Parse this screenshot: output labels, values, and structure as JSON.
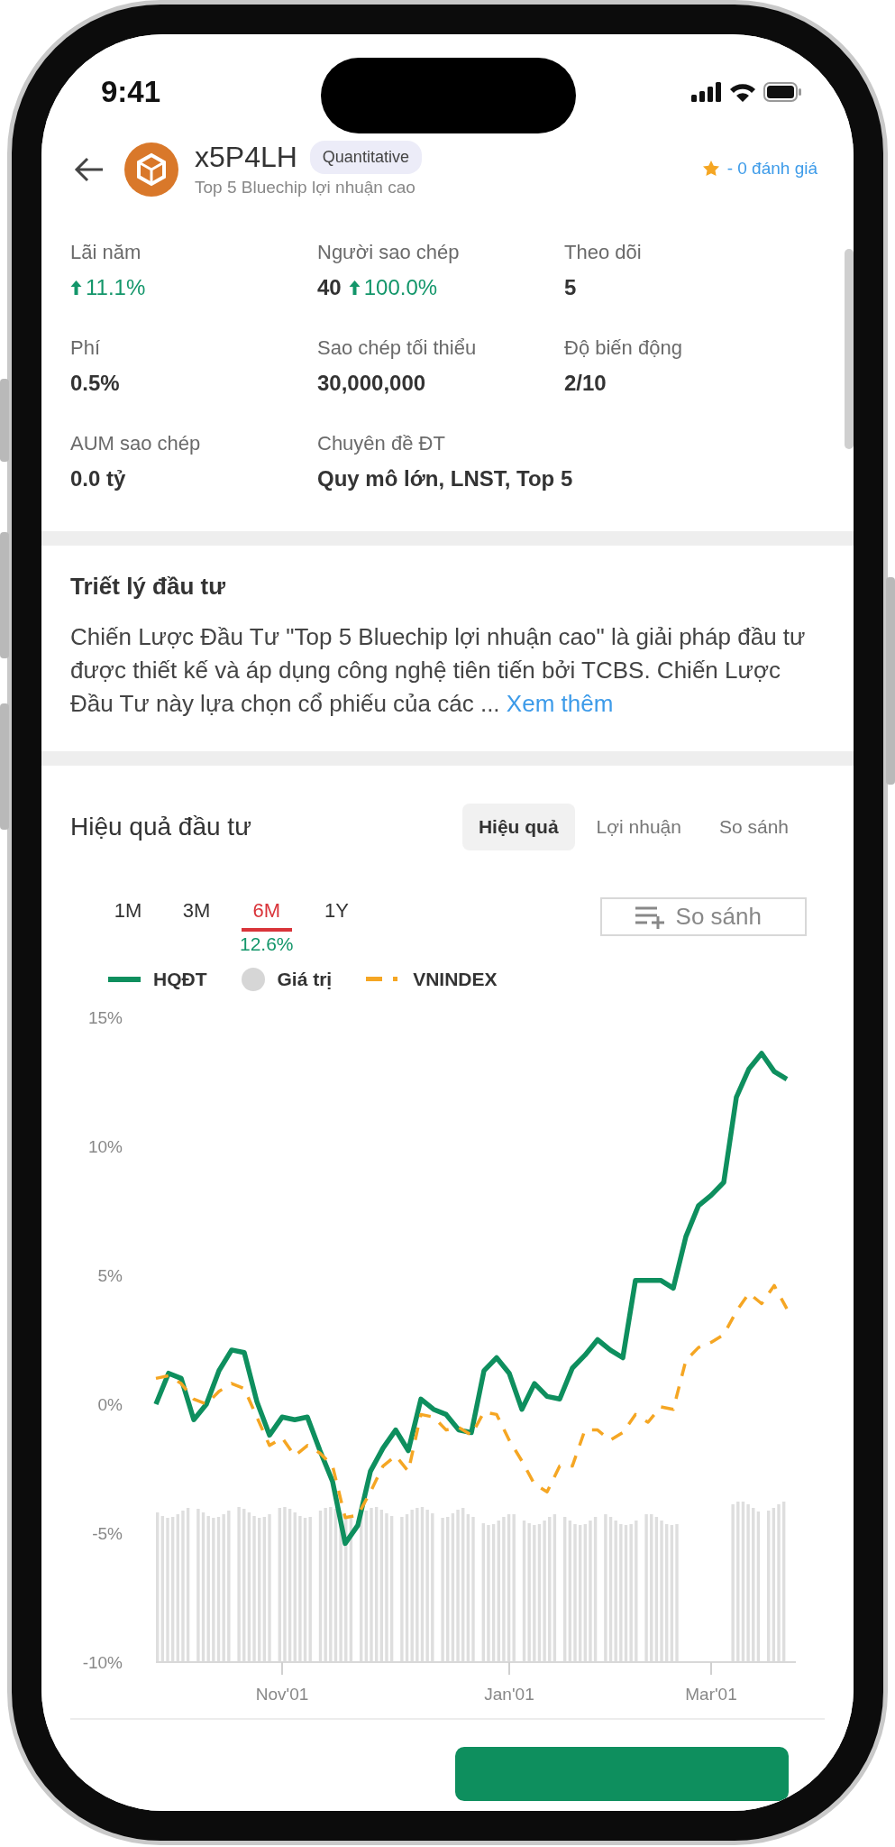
{
  "status_bar": {
    "time": "9:41"
  },
  "header": {
    "title": "x5P4LH",
    "badge": "Quantitative",
    "subtitle": "Top 5 Bluechip lợi nhuận cao",
    "rating": "- 0 đánh giá"
  },
  "stats": [
    {
      "label": "Lãi năm",
      "change": "11.1%"
    },
    {
      "label": "Người sao chép",
      "value": "40",
      "change": "100.0%"
    },
    {
      "label": "Theo dõi",
      "value": "5"
    },
    {
      "label": "Phí",
      "value": "0.5%"
    },
    {
      "label": "Sao chép tối thiểu",
      "value": "30,000,000"
    },
    {
      "label": "Độ biến động",
      "value": "2/10"
    },
    {
      "label": "AUM sao chép",
      "value": "0.0 tỷ"
    },
    {
      "label": "Chuyên đề ĐT",
      "value": "Quy mô lớn, LNST, Top 5"
    }
  ],
  "philosophy": {
    "title": "Triết lý đầu tư",
    "text": "Chiến Lược Đầu Tư \"Top 5 Bluechip lợi nhuận cao\" là giải pháp đầu tư được thiết kế và áp dụng công nghệ tiên tiến bởi TCBS. Chiến Lược Đầu Tư này lựa chọn cổ phiếu của các ...",
    "link": "Xem thêm"
  },
  "performance": {
    "title": "Hiệu quả đầu tư",
    "tabs": [
      {
        "label": "Hiệu quả",
        "selected": true
      },
      {
        "label": "Lợi nhuận",
        "selected": false
      },
      {
        "label": "So sánh",
        "selected": false
      }
    ],
    "ranges": [
      {
        "label": "1M",
        "selected": false
      },
      {
        "label": "3M",
        "selected": false
      },
      {
        "label": "6M",
        "selected": true,
        "change": "12.6%"
      },
      {
        "label": "1Y",
        "selected": false
      }
    ],
    "compare_button": "So sánh",
    "value_legend": {
      "label": "Giá trị",
      "color": "#d6d6d6"
    },
    "chart_data": {
      "type": "line",
      "categories": [
        null,
        null,
        null,
        null,
        null,
        null,
        null,
        null,
        null,
        null,
        "Nov'01",
        null,
        null,
        null,
        null,
        null,
        null,
        null,
        null,
        null,
        null,
        null,
        null,
        null,
        null,
        null,
        null,
        null,
        "Jan'01",
        null,
        null,
        null,
        null,
        null,
        null,
        null,
        null,
        null,
        null,
        null,
        null,
        null,
        null,
        null,
        "Mar'01",
        null,
        null,
        null,
        null,
        null,
        null
      ],
      "series": [
        {
          "name": "HQĐT",
          "color": "#0e8f5e",
          "line_style": "solid",
          "values": [
            0,
            1.2,
            1.0,
            -0.6,
            0.0,
            1.3,
            2.1,
            2.0,
            0.1,
            -1.2,
            -0.5,
            -0.6,
            -0.5,
            -1.8,
            -3.0,
            -5.4,
            -4.7,
            -2.6,
            -1.7,
            -1.0,
            -1.8,
            0.2,
            -0.2,
            -0.4,
            -1.0,
            -1.1,
            1.3,
            1.8,
            1.2,
            -0.2,
            0.8,
            0.3,
            0.2,
            1.4,
            1.9,
            2.5,
            2.1,
            1.8,
            4.8,
            4.8,
            4.8,
            4.5,
            6.5,
            7.7,
            8.1,
            8.6,
            11.9,
            13.0,
            13.6,
            12.9,
            12.6
          ]
        },
        {
          "name": "VNINDEX",
          "color": "#f5a623",
          "line_style": "dashed",
          "values": [
            1.0,
            1.1,
            0.8,
            0.2,
            0.0,
            0.5,
            0.8,
            0.6,
            -0.5,
            -1.6,
            -1.3,
            -2.0,
            -1.6,
            -1.9,
            -2.4,
            -4.4,
            -4.3,
            -3.4,
            -2.4,
            -2.0,
            -2.6,
            -0.4,
            -0.5,
            -1.0,
            -0.9,
            -1.2,
            -0.3,
            -0.4,
            -1.4,
            -2.2,
            -3.1,
            -3.4,
            -2.4,
            -2.4,
            -1.0,
            -1.0,
            -1.4,
            -1.1,
            -0.4,
            -0.7,
            -0.1,
            -0.2,
            1.7,
            2.2,
            2.4,
            2.7,
            3.6,
            4.3,
            3.9,
            4.6,
            3.7
          ]
        }
      ],
      "ylim": [
        -10,
        15
      ],
      "yticks": [
        {
          "value": 15,
          "label": "15%"
        },
        {
          "value": 10,
          "label": "10%"
        },
        {
          "value": 5,
          "label": "5%"
        },
        {
          "value": 0,
          "label": "0%"
        },
        {
          "value": -5,
          "label": "-5%"
        },
        {
          "value": -10,
          "label": "-10%"
        }
      ]
    }
  }
}
